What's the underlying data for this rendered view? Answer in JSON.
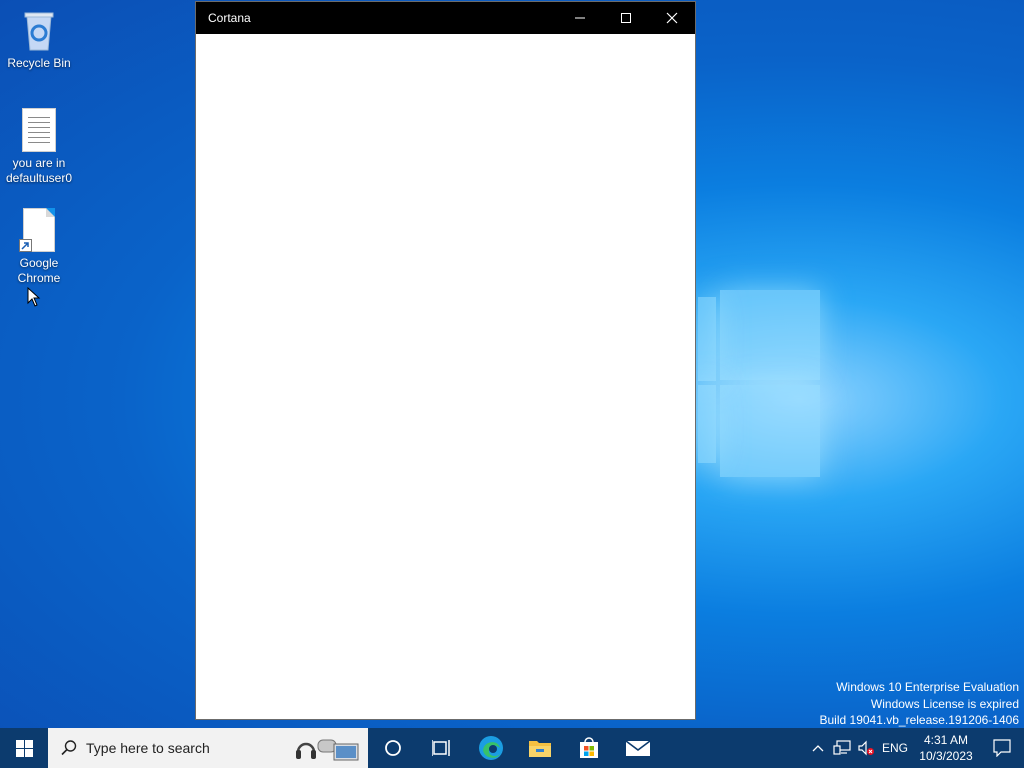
{
  "desktop": {
    "icons": [
      {
        "label": "Recycle Bin"
      },
      {
        "label": "you are in defaultuser0"
      },
      {
        "label": "Google Chrome"
      }
    ]
  },
  "window": {
    "title": "Cortana",
    "controls": {
      "minimize": "minimize",
      "maximize": "maximize",
      "close": "close"
    }
  },
  "watermark": {
    "line1": "Windows 10 Enterprise Evaluation",
    "line2": "Windows License is expired",
    "line3": "Build 19041.vb_release.191206-1406"
  },
  "taskbar": {
    "search_placeholder": "Type here to search",
    "apps": [
      "cortana-icon",
      "task-view-icon",
      "edge-icon",
      "file-explorer-icon",
      "store-icon",
      "mail-icon"
    ],
    "language": "ENG",
    "time": "4:31 AM",
    "date": "10/3/2023"
  },
  "colors": {
    "taskbar": "#0c3b6e",
    "titlebar": "#000000",
    "accent": "#0a63c9"
  }
}
